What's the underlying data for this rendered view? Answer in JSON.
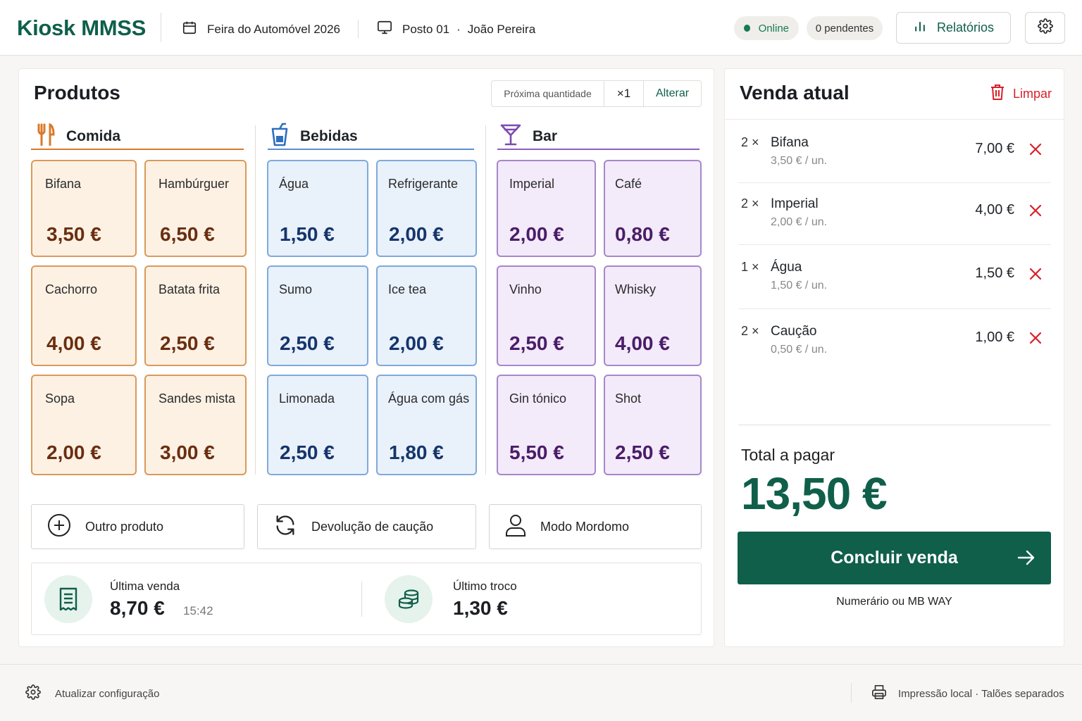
{
  "header": {
    "brand": "Kiosk MMSS",
    "event": "Feira do Automóvel 2026",
    "station": "Posto 01",
    "station_sep": "·",
    "operator": "João Pereira",
    "status": "Online",
    "pending": "0 pendentes",
    "reports_label": "Relatórios",
    "icons": {
      "event": "calendar-icon",
      "station": "monitor-icon",
      "reports": "bar-chart-icon",
      "settings": "gear-icon"
    }
  },
  "products": {
    "title": "Produtos",
    "next_qty_label": "Próxima quantidade",
    "next_qty_value": "×1",
    "change_label": "Alterar",
    "categories": [
      {
        "name": "Comida",
        "icon": "fork-knife-icon",
        "color": "#d9792a",
        "items": [
          {
            "name": "Bifana",
            "price": "3,50 €"
          },
          {
            "name": "Hambúrguer",
            "price": "6,50 €"
          },
          {
            "name": "Cachorro",
            "price": "4,00 €"
          },
          {
            "name": "Batata frita",
            "price": "2,50 €"
          },
          {
            "name": "Sopa",
            "price": "2,00 €"
          },
          {
            "name": "Sandes mista",
            "price": "3,00 €"
          }
        ]
      },
      {
        "name": "Bebidas",
        "icon": "cup-icon",
        "color": "#2f6fc0",
        "items": [
          {
            "name": "Água",
            "price": "1,50 €"
          },
          {
            "name": "Refrigerante",
            "price": "2,00 €"
          },
          {
            "name": "Sumo",
            "price": "2,50 €"
          },
          {
            "name": "Ice tea",
            "price": "2,00 €"
          },
          {
            "name": "Limonada",
            "price": "2,50 €"
          },
          {
            "name": "Água com gás",
            "price": "1,80 €"
          }
        ]
      },
      {
        "name": "Bar",
        "icon": "cocktail-icon",
        "color": "#7a4bb0",
        "items": [
          {
            "name": "Imperial",
            "price": "2,00 €"
          },
          {
            "name": "Café",
            "price": "0,80 €"
          },
          {
            "name": "Vinho",
            "price": "2,50 €"
          },
          {
            "name": "Whisky",
            "price": "4,00 €"
          },
          {
            "name": "Gin tónico",
            "price": "5,50 €"
          },
          {
            "name": "Shot",
            "price": "2,50 €"
          }
        ]
      }
    ],
    "actions": {
      "other": "Outro produto",
      "deposit_return": "Devolução de caução",
      "butler": "Modo Mordomo"
    },
    "last_sale": {
      "label": "Última venda",
      "value": "8,70 €",
      "time": "15:42"
    },
    "last_change": {
      "label": "Último troco",
      "value": "1,30 €"
    }
  },
  "sale": {
    "title": "Venda atual",
    "clear_label": "Limpar",
    "items": [
      {
        "qty": "2 ×",
        "name": "Bifana",
        "unit": "3,50 € / un.",
        "total": "7,00 €"
      },
      {
        "qty": "2 ×",
        "name": "Imperial",
        "unit": "2,00 € / un.",
        "total": "4,00 €"
      },
      {
        "qty": "1 ×",
        "name": "Água",
        "unit": "1,50 € / un.",
        "total": "1,50 €"
      },
      {
        "qty": "2 ×",
        "name": "Caução",
        "unit": "0,50 € / un.",
        "total": "1,00 €"
      }
    ],
    "total_label": "Total a pagar",
    "total_value": "13,50 €",
    "conclude_label": "Concluir venda",
    "payment_hint": "Numerário ou MB WAY"
  },
  "footer": {
    "update_config": "Atualizar configuração",
    "print_mode": "Impressão local · Talões separados"
  },
  "colors": {
    "brand": "#0f5f4a",
    "danger": "#d8202a",
    "food": "#d99a5a",
    "drinks": "#7fa9d9",
    "bar": "#a787c9"
  }
}
